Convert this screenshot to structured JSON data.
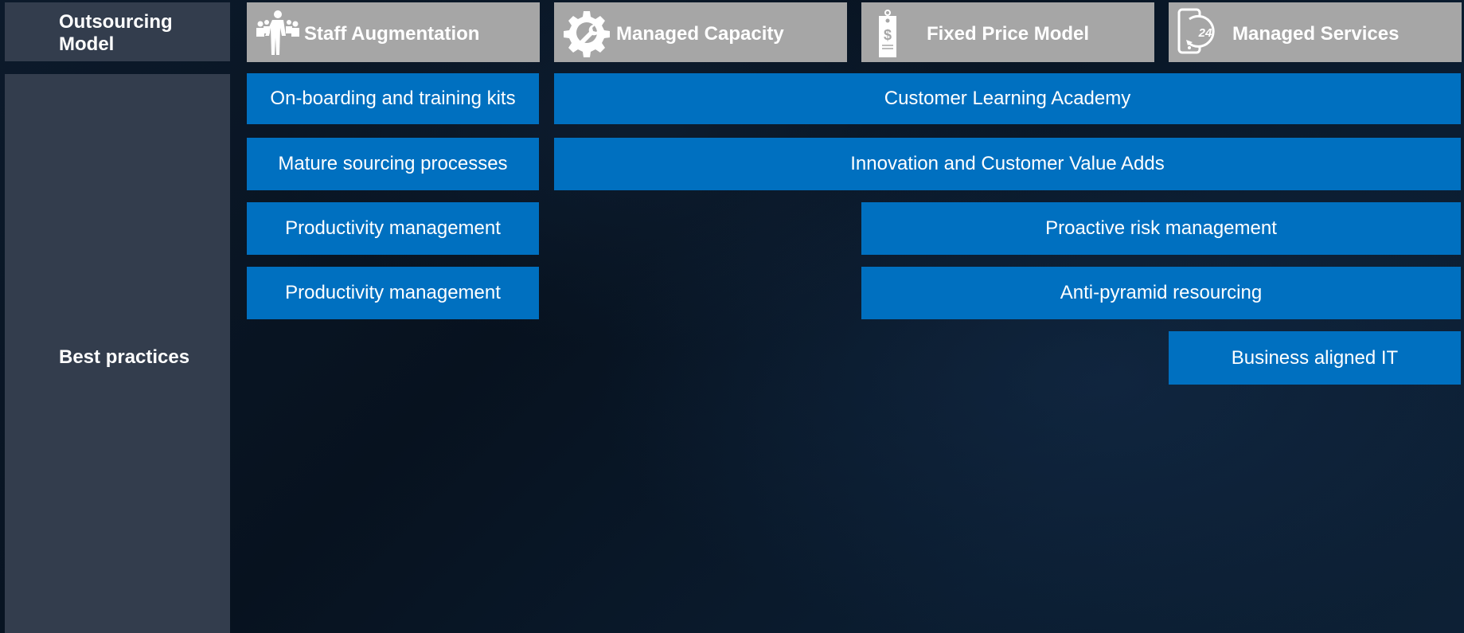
{
  "labels": {
    "model": "Outsourcing Model",
    "best_practices": "Best practices"
  },
  "models": [
    {
      "name": "Staff Augmentation",
      "icon": "people-icon"
    },
    {
      "name": "Managed Capacity",
      "icon": "gear-wrench-icon"
    },
    {
      "name": "Fixed Price Model",
      "icon": "price-tag-icon"
    },
    {
      "name": "Managed Services",
      "icon": "phone-24-icon",
      "icon_text": "24"
    }
  ],
  "practices": [
    {
      "label": "On-boarding and training kits",
      "models": [
        "Staff Augmentation"
      ]
    },
    {
      "label": "Customer Learning Academy",
      "models": [
        "Managed Capacity",
        "Fixed Price Model",
        "Managed Services"
      ]
    },
    {
      "label": "Mature sourcing processes",
      "models": [
        "Staff Augmentation"
      ]
    },
    {
      "label": "Innovation and Customer Value Adds",
      "models": [
        "Managed Capacity",
        "Fixed Price Model",
        "Managed Services"
      ]
    },
    {
      "label": "Productivity management",
      "models": [
        "Staff Augmentation"
      ]
    },
    {
      "label": "Proactive risk management",
      "models": [
        "Fixed Price Model",
        "Managed Services"
      ]
    },
    {
      "label": "Productivity management",
      "models": [
        "Staff Augmentation"
      ]
    },
    {
      "label": "Anti-pyramid resourcing",
      "models": [
        "Fixed Price Model",
        "Managed Services"
      ]
    },
    {
      "label": "Business aligned IT",
      "models": [
        "Managed Services"
      ]
    }
  ],
  "colors": {
    "label_column": "#333d4d",
    "model_header": "#a6a6a6",
    "practice_cell": "#0070c0",
    "text": "#ffffff"
  }
}
